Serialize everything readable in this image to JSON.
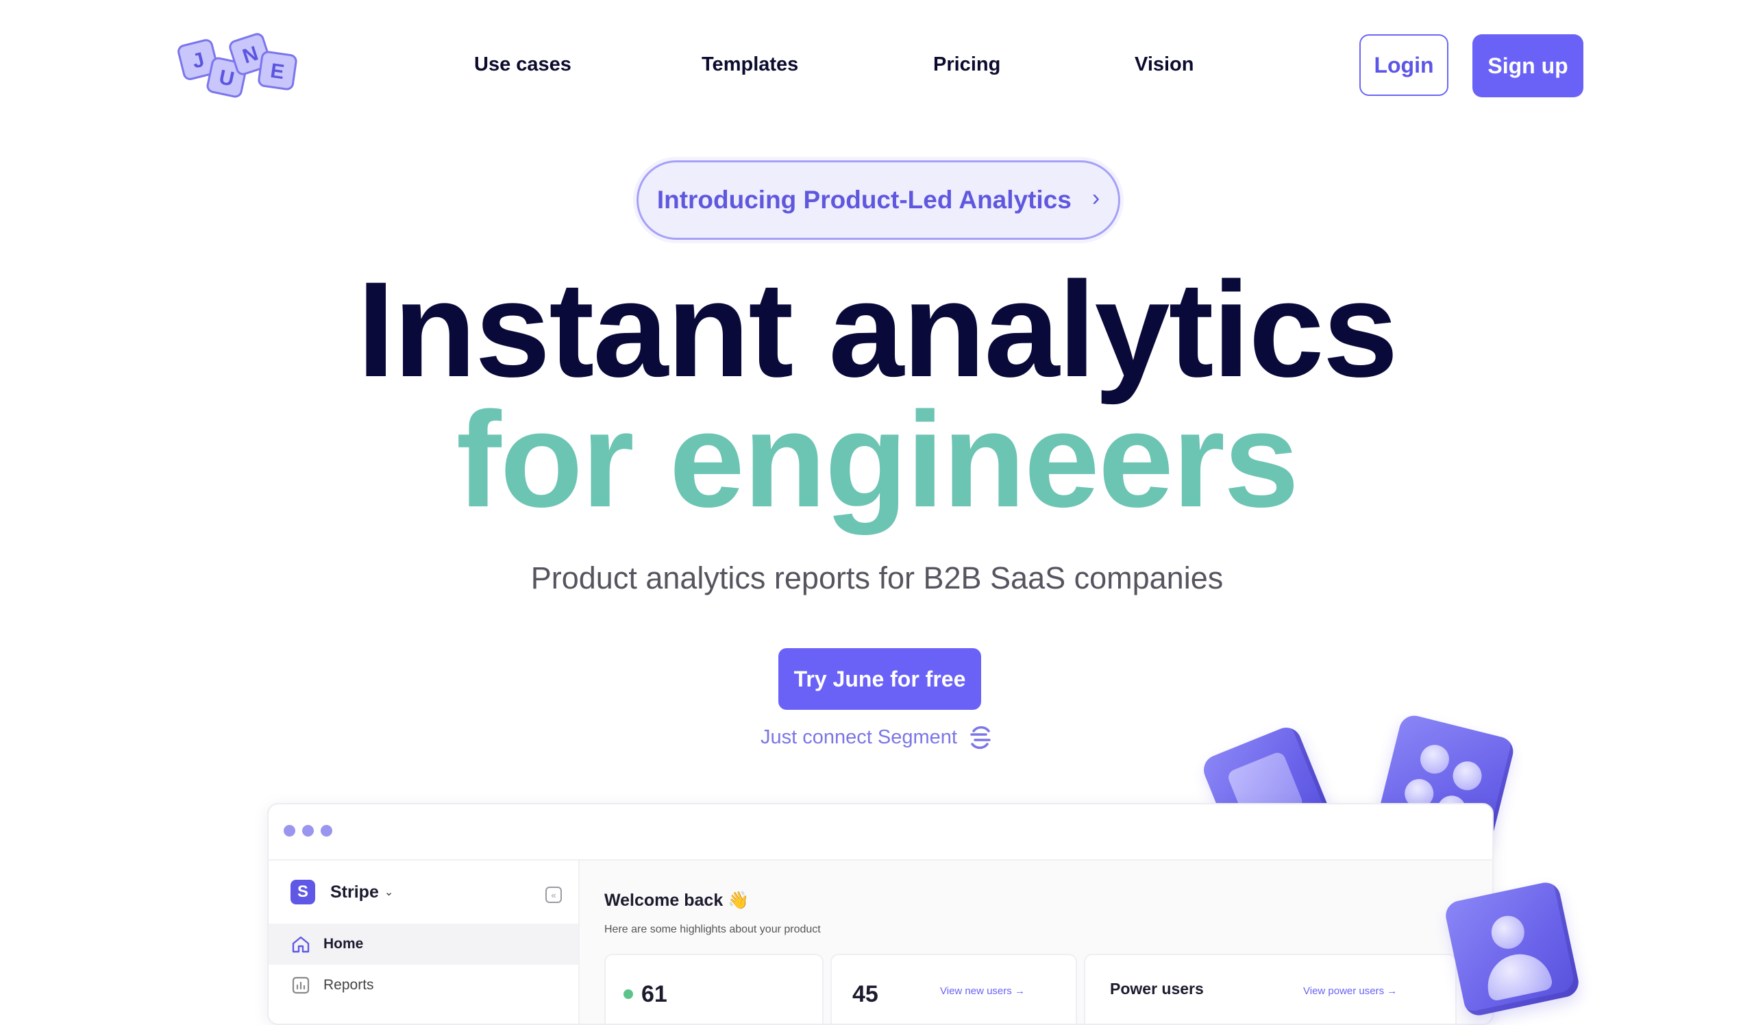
{
  "brand": {
    "logo_letters": [
      "J",
      "U",
      "N",
      "E"
    ],
    "accent_color": "#6a62f7",
    "headline_dark_color": "#0a0a3a",
    "headline_teal_color": "#6cc4b3"
  },
  "nav": {
    "items": [
      {
        "label": "Use cases"
      },
      {
        "label": "Templates"
      },
      {
        "label": "Pricing"
      },
      {
        "label": "Vision"
      }
    ],
    "login_label": "Login",
    "signup_label": "Sign up"
  },
  "hero": {
    "announcement": "Introducing Product-Led Analytics",
    "announcement_icon": "chevron-right-icon",
    "headline_line1": "Instant analytics",
    "headline_line2": "for engineers",
    "subtitle": "Product analytics reports for B2B SaaS companies",
    "cta_label": "Try June for free",
    "segment_note": "Just connect Segment",
    "segment_icon": "segment-logo-icon"
  },
  "app_preview": {
    "workspace": {
      "badge": "S",
      "name": "Stripe"
    },
    "sidebar_items": [
      {
        "label": "Home",
        "icon": "home-icon"
      },
      {
        "label": "Reports",
        "icon": "reports-icon"
      }
    ],
    "welcome_title": "Welcome back 👋",
    "welcome_subtitle": "Here are some highlights about your product",
    "cards": [
      {
        "value": "61"
      },
      {
        "value": "45",
        "link": "View new users →"
      },
      {
        "title": "Power users",
        "link": "View power users →"
      }
    ]
  }
}
